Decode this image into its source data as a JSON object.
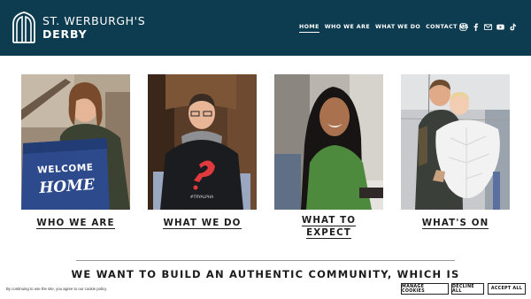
{
  "brand": {
    "line1": "ST. WERBURGH'S",
    "line2": "DERBY",
    "logo_icon": "church-window-icon"
  },
  "nav": {
    "items": [
      {
        "label": "HOME",
        "active": true
      },
      {
        "label": "WHO WE ARE",
        "active": false
      },
      {
        "label": "WHAT WE DO",
        "active": false
      },
      {
        "label": "CONTACT US",
        "active": false
      }
    ]
  },
  "social": {
    "icons": [
      "instagram-icon",
      "facebook-icon",
      "email-icon",
      "youtube-icon",
      "tiktok-icon"
    ]
  },
  "cards": [
    {
      "title": "WHO WE ARE",
      "sign_line1": "WELCOME",
      "sign_line2": "HOME"
    },
    {
      "title": "WHAT WE DO",
      "shirt_text": "#TRYALPHA"
    },
    {
      "title_line1": "WHAT TO",
      "title_line2": "EXPECT"
    },
    {
      "title": "WHAT'S ON"
    }
  ],
  "mission": {
    "text": "WE WANT TO BUILD AN AUTHENTIC COMMUNITY, WHICH IS"
  },
  "cookie_bar": {
    "text": "By continuing to use the site, you agree to our cookie policy.",
    "manage_label": "MANAGE COOKIES",
    "decline_label": "DECLINE ALL",
    "accept_label": "ACCEPT ALL"
  },
  "colors": {
    "header_bg": "#0d3c50",
    "text_dark": "#1d1d1d",
    "accent_red": "#e03a3e"
  }
}
